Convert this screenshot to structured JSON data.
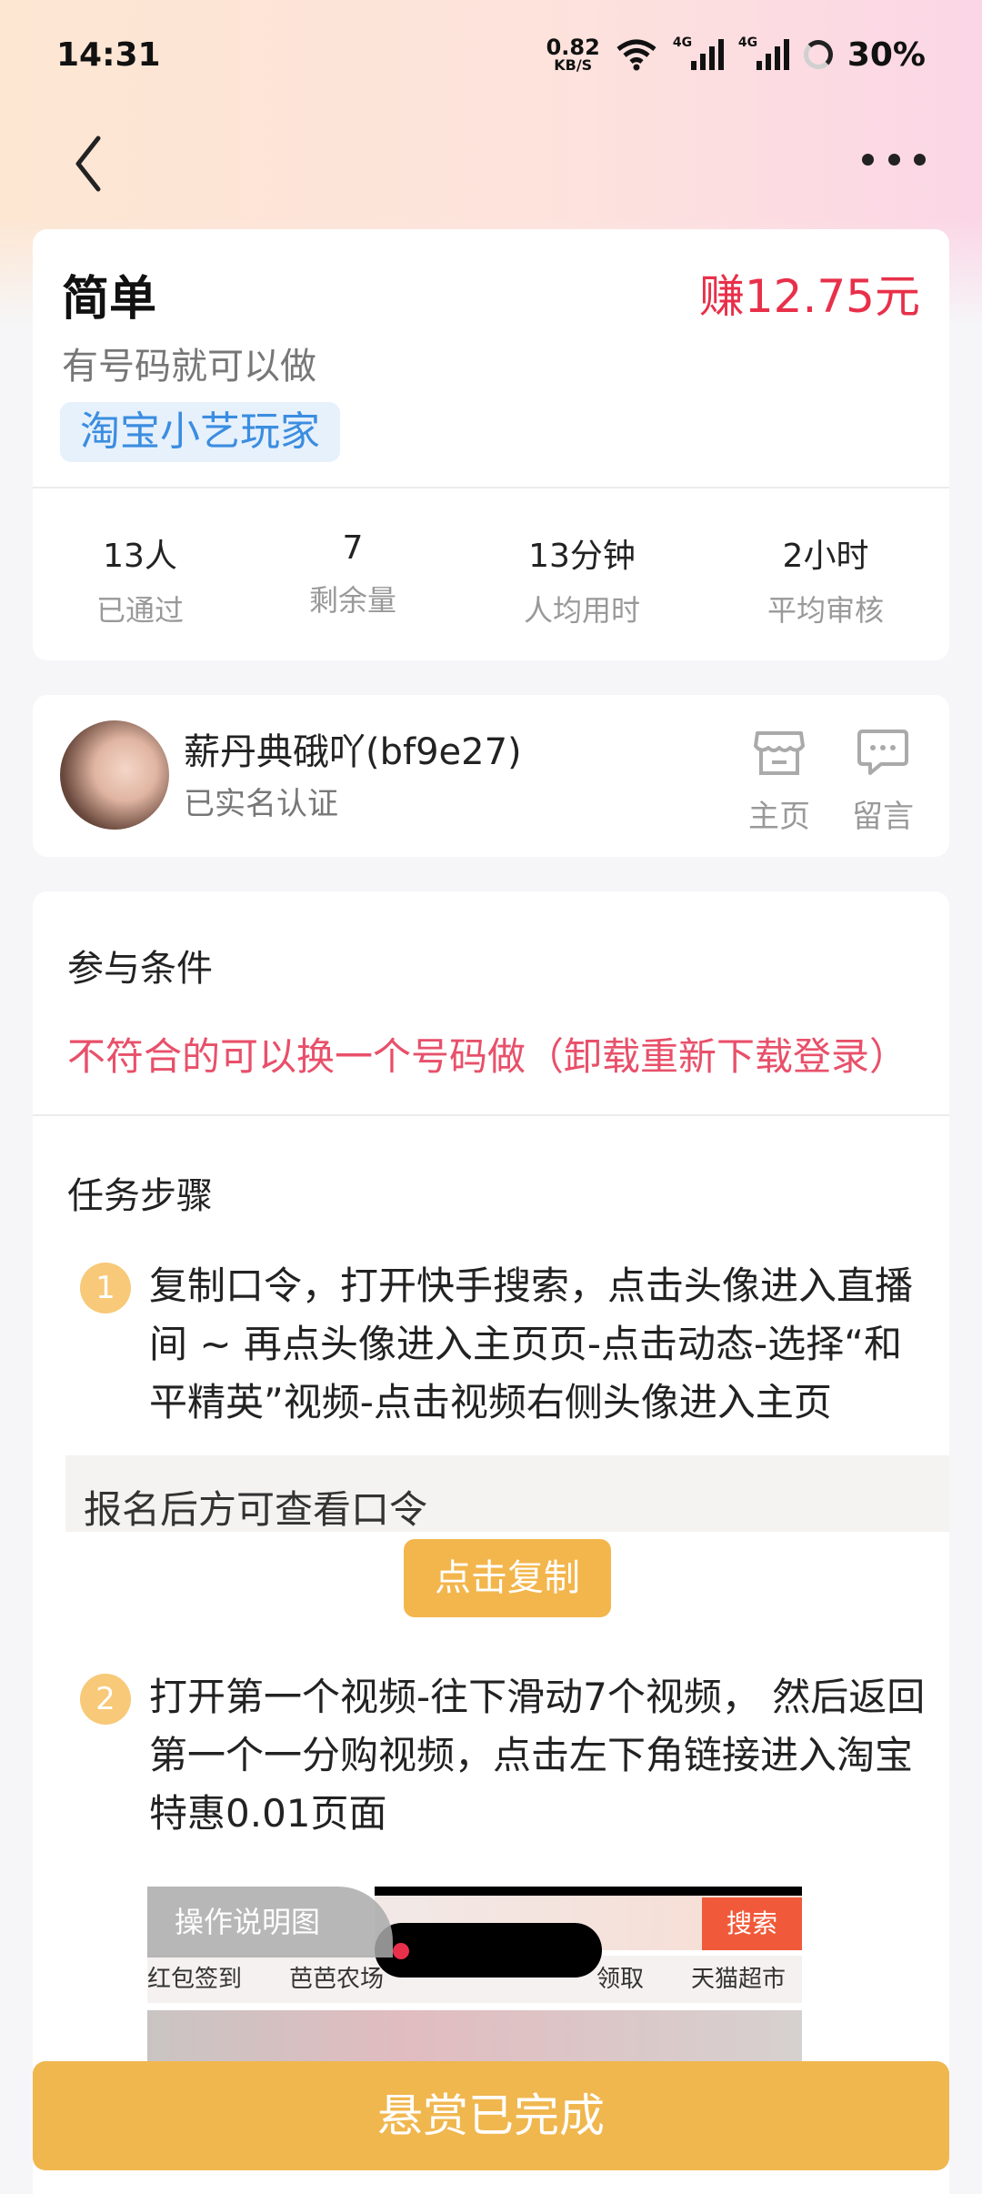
{
  "status_bar": {
    "time": "14:31",
    "net_speed_value": "0.82",
    "net_speed_unit": "KB/S",
    "signal1_label": "4G",
    "signal2_label": "4G",
    "battery": "30%"
  },
  "task": {
    "title": "简单",
    "reward": "赚12.75元",
    "subtitle": "有号码就可以做",
    "tag": "淘宝小艺玩家"
  },
  "stats": [
    {
      "value": "13人",
      "label": "已通过"
    },
    {
      "value": "7",
      "label": "剩余量"
    },
    {
      "value": "13分钟",
      "label": "人均用时"
    },
    {
      "value": "2小时",
      "label": "平均审核"
    }
  ],
  "publisher": {
    "name": "薪丹典硪吖(bf9e27)",
    "verified": "已实名认证",
    "home_label": "主页",
    "message_label": "留言"
  },
  "conditions": {
    "title": "参与条件",
    "text": "不符合的可以换一个号码做（卸载重新下载登录）"
  },
  "steps": {
    "title": "任务步骤",
    "items": [
      {
        "num": "1",
        "text": "复制口令，打开快手搜索，点击头像进入直播间 ~ 再点头像进入主页页-点击动态-选择“和平精英”视频-点击视频右侧头像进入主页"
      },
      {
        "num": "2",
        "text": "打开第一个视频-往下滑动7个视频， 然后返回第一个一分购视频，点击左下角链接进入淘宝特惠0.01页面"
      }
    ],
    "command_placeholder": "报名后方可查看口令",
    "copy_button": "点击复制",
    "image_tag": "操作说明图",
    "image_texts": {
      "search": "搜索",
      "row": "红包签到　　芭芭农场　　　　　　　　　领取　　天猫超市"
    }
  },
  "bottom_button": "悬赏已完成",
  "colors": {
    "reward": "#e8304a",
    "tag_text": "#3b8de0",
    "condition_text": "#e8506a",
    "accent": "#f0b74f",
    "step_badge": "#f7c978"
  }
}
